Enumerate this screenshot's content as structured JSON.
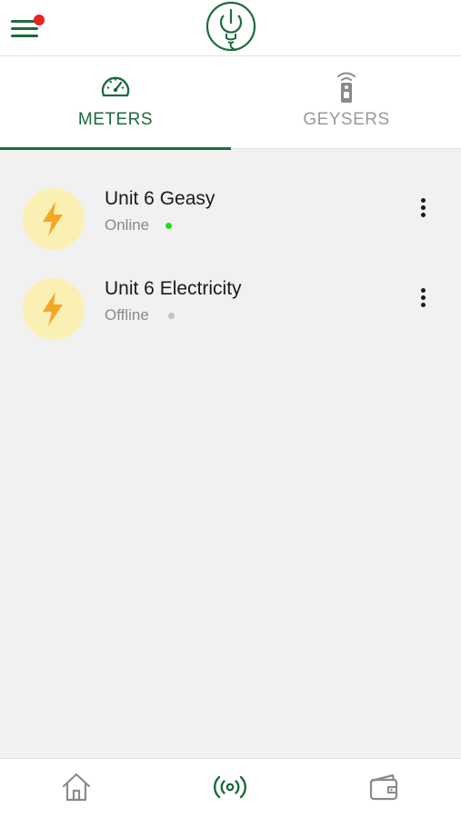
{
  "header": {
    "menu_icon": "hamburger-menu-icon",
    "notification_color": "#e5261f",
    "logo_icon": "power-bulb-logo-icon"
  },
  "tabs": [
    {
      "label": "METERS",
      "icon": "speedometer-icon",
      "active": true
    },
    {
      "label": "GEYSERS",
      "icon": "remote-control-icon",
      "active": false
    }
  ],
  "devices": [
    {
      "name": "Unit 6 Geasy",
      "status": "Online",
      "status_color": "#22dd22",
      "icon": "lightning-bolt-icon"
    },
    {
      "name": "Unit 6 Electricity",
      "status": "Offline",
      "status_color": "#c4c4c4",
      "icon": "lightning-bolt-icon"
    }
  ],
  "bottom_nav": [
    {
      "name": "home",
      "icon": "home-icon",
      "active": false
    },
    {
      "name": "devices",
      "icon": "broadcast-icon",
      "active": true
    },
    {
      "name": "wallet",
      "icon": "wallet-icon",
      "active": false
    }
  ],
  "colors": {
    "brand": "#1c6b3d",
    "background": "#f1f1f1",
    "bolt": "#f5a623",
    "bolt_bg": "#fbf0b4"
  }
}
